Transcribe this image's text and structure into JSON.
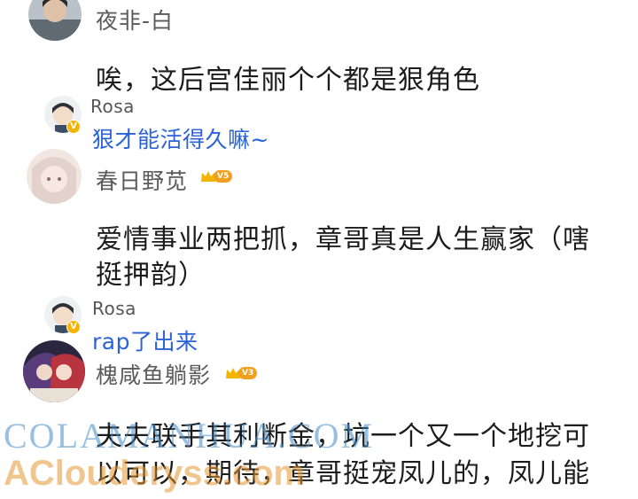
{
  "comments": [
    {
      "username": "夜非-白",
      "text_lines": [
        "唉，这后宫佳丽个个都是狠角色"
      ],
      "reply": {
        "username": "Rosa",
        "text": "狠才能活得久嘛~"
      }
    },
    {
      "username": "春日野苋",
      "level": "V5",
      "text_lines": [
        "爱情事业两把抓，章哥真是人生赢家（嗐",
        "挺押韵）"
      ],
      "reply": {
        "username": "Rosa",
        "text": "rap了出来"
      }
    },
    {
      "username": "槐咸鱼躺影",
      "level": "V3",
      "text_lines": [
        "夫夫联手其利断金，坑一个又一个地挖可",
        "以可以，期待，章哥挺宠凤儿的，凤儿能"
      ]
    }
  ],
  "watermark": {
    "line1": "COLAMANHUA.COM",
    "line2": "AClouderyss.com"
  },
  "colors": {
    "reply_link": "#2b62d6",
    "username": "#5b5b5b",
    "level_badge": "#f0a020"
  }
}
